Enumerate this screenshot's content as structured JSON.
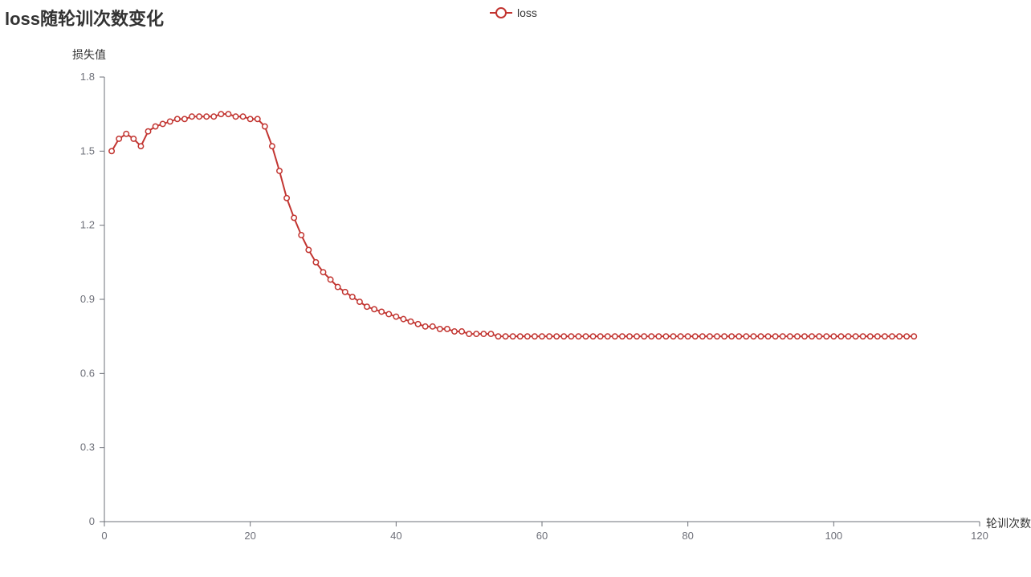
{
  "chart_data": {
    "type": "line",
    "title": "loss随轮训次数变化",
    "xlabel": "轮训次数",
    "ylabel": "损失值",
    "xlim": [
      0,
      120
    ],
    "ylim": [
      0,
      1.8
    ],
    "x_ticks": [
      0,
      20,
      40,
      60,
      80,
      100,
      120
    ],
    "y_ticks": [
      0,
      0.3,
      0.6,
      0.9,
      1.2,
      1.5,
      1.8
    ],
    "series": [
      {
        "name": "loss",
        "color": "#c23531",
        "x": [
          1,
          2,
          3,
          4,
          5,
          6,
          7,
          8,
          9,
          10,
          11,
          12,
          13,
          14,
          15,
          16,
          17,
          18,
          19,
          20,
          21,
          22,
          23,
          24,
          25,
          26,
          27,
          28,
          29,
          30,
          31,
          32,
          33,
          34,
          35,
          36,
          37,
          38,
          39,
          40,
          41,
          42,
          43,
          44,
          45,
          46,
          47,
          48,
          49,
          50,
          51,
          52,
          53,
          54,
          55,
          56,
          57,
          58,
          59,
          60,
          61,
          62,
          63,
          64,
          65,
          66,
          67,
          68,
          69,
          70,
          71,
          72,
          73,
          74,
          75,
          76,
          77,
          78,
          79,
          80,
          81,
          82,
          83,
          84,
          85,
          86,
          87,
          88,
          89,
          90,
          91,
          92,
          93,
          94,
          95,
          96,
          97,
          98,
          99,
          100,
          101,
          102,
          103,
          104,
          105,
          106,
          107,
          108,
          109,
          110,
          111
        ],
        "values": [
          1.5,
          1.55,
          1.57,
          1.55,
          1.52,
          1.58,
          1.6,
          1.61,
          1.62,
          1.63,
          1.63,
          1.64,
          1.64,
          1.64,
          1.64,
          1.65,
          1.65,
          1.64,
          1.64,
          1.63,
          1.63,
          1.6,
          1.52,
          1.42,
          1.31,
          1.23,
          1.16,
          1.1,
          1.05,
          1.01,
          0.98,
          0.95,
          0.93,
          0.91,
          0.89,
          0.87,
          0.86,
          0.85,
          0.84,
          0.83,
          0.82,
          0.81,
          0.8,
          0.79,
          0.79,
          0.78,
          0.78,
          0.77,
          0.77,
          0.76,
          0.76,
          0.76,
          0.76,
          0.75,
          0.75,
          0.75,
          0.75,
          0.75,
          0.75,
          0.75,
          0.75,
          0.75,
          0.75,
          0.75,
          0.75,
          0.75,
          0.75,
          0.75,
          0.75,
          0.75,
          0.75,
          0.75,
          0.75,
          0.75,
          0.75,
          0.75,
          0.75,
          0.75,
          0.75,
          0.75,
          0.75,
          0.75,
          0.75,
          0.75,
          0.75,
          0.75,
          0.75,
          0.75,
          0.75,
          0.75,
          0.75,
          0.75,
          0.75,
          0.75,
          0.75,
          0.75,
          0.75,
          0.75,
          0.75,
          0.75,
          0.75,
          0.75,
          0.75,
          0.75,
          0.75,
          0.75,
          0.75,
          0.75,
          0.75,
          0.75,
          0.75
        ]
      }
    ]
  },
  "legend": {
    "label": "loss"
  }
}
